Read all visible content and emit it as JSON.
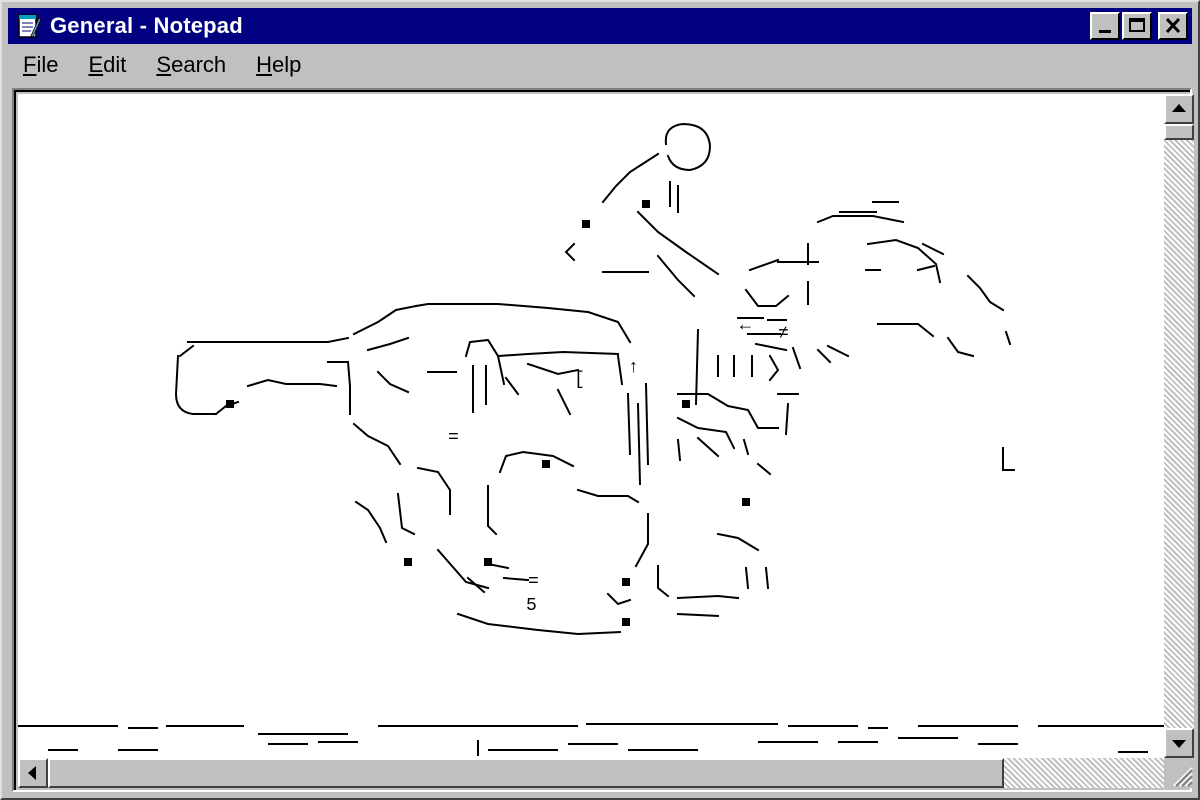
{
  "window": {
    "title": "General - Notepad",
    "titlebar_color": "#000080",
    "icon": "notepad-icon"
  },
  "menu": {
    "items": [
      {
        "name": "file",
        "label": "File",
        "accel": "F",
        "rest": "ile"
      },
      {
        "name": "edit",
        "label": "Edit",
        "accel": "E",
        "rest": "dit"
      },
      {
        "name": "search",
        "label": "Search",
        "accel": "S",
        "rest": "earch"
      },
      {
        "name": "help",
        "label": "Help",
        "accel": "H",
        "rest": "elp"
      }
    ]
  },
  "document": {
    "content_type": "ascii-art",
    "subject": "horse-racing-jockey-ascii-art",
    "digits_visible": [
      "5"
    ]
  },
  "controls": {
    "minimize_icon": "minimize-icon",
    "maximize_icon": "maximize-icon",
    "close_icon": "close-icon"
  }
}
